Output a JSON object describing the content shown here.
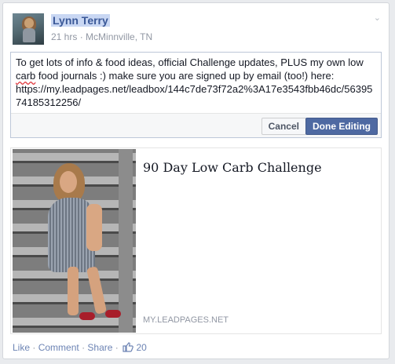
{
  "post": {
    "author": "Lynn Terry",
    "time": "21 hrs",
    "separator": "·",
    "location": "McMinnville, TN",
    "chevron": "⌄"
  },
  "editor": {
    "text_before": "To get lots of info & food ideas, official Challenge updates, PLUS my own low ",
    "text_misspelled": "carb",
    "text_after": " food journals :) make sure you are signed up by email (too!) here: https://my.leadpages.net/leadbox/144c7de73f72a2%3A17e3543fbb46dc/5639574185312256/",
    "cancel_label": "Cancel",
    "done_label": "Done Editing"
  },
  "link": {
    "title": "90 Day Low Carb Challenge",
    "domain": "MY.LEADPAGES.NET"
  },
  "actions": {
    "like": "Like",
    "comment": "Comment",
    "share": "Share",
    "dot": "·",
    "like_count": "20"
  },
  "icons": {
    "like_thumb": "thumbs-up-icon",
    "options": "chevron-down-icon"
  },
  "colors": {
    "link_blue": "#3b5998",
    "button_blue": "#4e69a2",
    "meta_gray": "#9197a3"
  }
}
